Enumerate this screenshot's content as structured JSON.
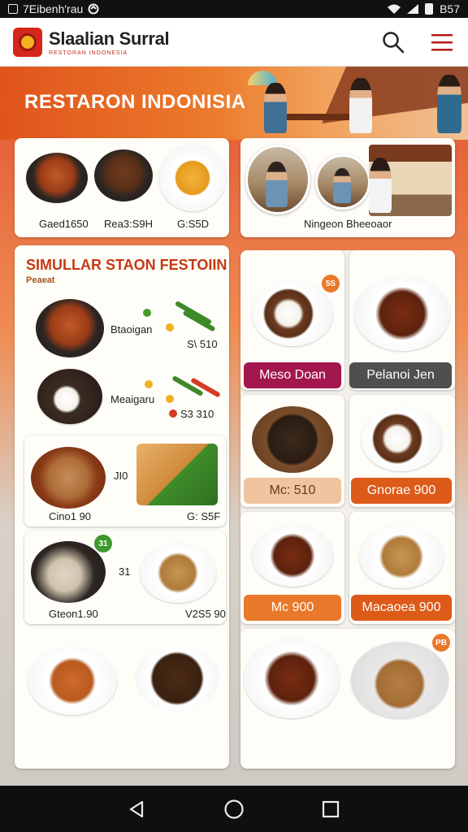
{
  "status_bar": {
    "left_text": "7Eibenh'rau",
    "time": "B57",
    "icons": [
      "screenshot-icon",
      "sync-icon",
      "wifi-icon",
      "signal-icon",
      "battery-icon"
    ]
  },
  "header": {
    "brand_name": "Slaalian Surral",
    "brand_subtitle": "RESTORAN INDONESIA",
    "icons": [
      "search-icon",
      "menu-icon"
    ],
    "accent_color": "#d5271c"
  },
  "hero": {
    "title": "RESTARON INDONISIA"
  },
  "top_left_card": {
    "items": [
      {
        "label": "Gaed1650"
      },
      {
        "label": "Rea3:S9H"
      },
      {
        "label": "G:S5D"
      }
    ]
  },
  "top_right_card": {
    "caption": "Ningeon Bheeoaor"
  },
  "left_menu": {
    "title": "SIMULLAR STAON FESTOIIN",
    "subtitle": "Peaeat",
    "rows": [
      {
        "label": "Btaoigan",
        "price": "S\\ 510"
      },
      {
        "label": "Meaigaru",
        "price": "S3 310"
      }
    ],
    "pair_one": {
      "num": "JI0",
      "left_label": "Cino1 90",
      "right_label": "G: S5F"
    },
    "pair_two": {
      "num": "31",
      "left_label": "Gteon1.90",
      "right_label": "V2S5 90",
      "badge": "31"
    }
  },
  "right_grid": {
    "cells": [
      {
        "label": "Meso Doan",
        "color": "#a3174f",
        "badge": "5S"
      },
      {
        "label": "Pelanoi Jen",
        "color": "#4f4f4f"
      },
      {
        "label": "Mc: 510",
        "color": "#f1c39e"
      },
      {
        "label": "Gnorae 900",
        "color": "#dd5a19"
      },
      {
        "label": "Mc 900",
        "color": "#e9782a"
      },
      {
        "label": "Macaoea 900",
        "color": "#dd5a19"
      }
    ],
    "bottom_badge": "PB"
  },
  "nav_bar": {
    "icons": [
      "back-icon",
      "home-icon",
      "recents-icon"
    ]
  }
}
